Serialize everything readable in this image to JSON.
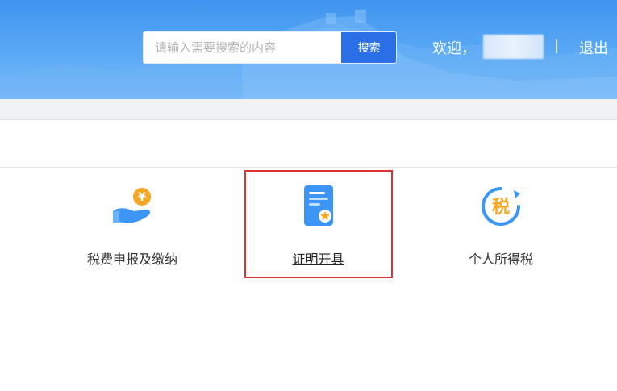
{
  "header": {
    "search": {
      "placeholder": "请输入需要搜索的内容",
      "button_label": "搜索"
    },
    "welcome_text": "欢迎，",
    "divider": "|",
    "logout_label": "退出"
  },
  "services": [
    {
      "label": "税费申报及缴纳",
      "icon": "hand-coin-icon"
    },
    {
      "label": "证明开具",
      "icon": "certificate-icon"
    },
    {
      "label": "个人所得税",
      "icon": "tax-refresh-icon"
    }
  ],
  "icon_glyphs": {
    "coin": "¥",
    "tax": "税"
  },
  "colors": {
    "header_blue": "#4a9cf2",
    "search_button": "#2b6fe6",
    "icon_blue": "#3d96f5",
    "icon_orange": "#f7a623",
    "highlight_red": "#e03232"
  }
}
